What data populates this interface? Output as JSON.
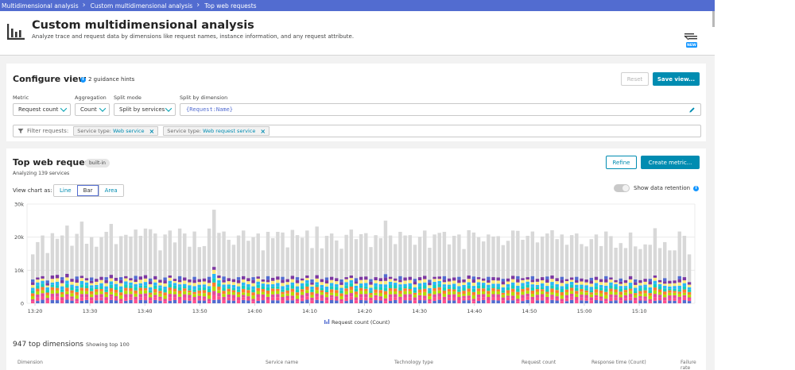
{
  "breadcrumb": [
    "Multidimensional analysis",
    "Custom multidimensional analysis",
    "Top web requests"
  ],
  "header": {
    "title": "Custom multidimensional analysis",
    "subtitle": "Analyze trace and request data by dimensions like request names, instance information, and any request attribute.",
    "new_badge": "NEW"
  },
  "config": {
    "title": "Configure view",
    "hints": "2 guidance hints",
    "reset_label": "Reset",
    "save_label": "Save view...",
    "metric_label": "Metric",
    "metric_value": "Request count",
    "aggregation_label": "Aggregation",
    "aggregation_value": "Count",
    "split_mode_label": "Split mode",
    "split_mode_value": "Split by services",
    "split_dimension_label": "Split by dimension",
    "split_dimension_value": "{Request:Name}",
    "filter_label": "Filter requests:",
    "filters": [
      {
        "key": "Service type:",
        "value": "Web service"
      },
      {
        "key": "Service type:",
        "value": "Web request service"
      }
    ]
  },
  "chart_panel": {
    "title": "Top web requests",
    "badge": "built-in",
    "analyzing": "Analyzing 139 services",
    "refine_label": "Refine",
    "create_metric_label": "Create metric...",
    "view_as_label": "View chart as:",
    "view_options": [
      "Line",
      "Bar",
      "Area"
    ],
    "view_selected": "Bar",
    "retention_label": "Show data retention",
    "legend_label": "Request count (Count)"
  },
  "chart_data": {
    "type": "bar",
    "y_ticks": [
      "30k",
      "20k",
      "10k",
      "0"
    ],
    "ylim": [
      0,
      30000
    ],
    "x_ticks": [
      "13:20",
      "13:30",
      "13:40",
      "13:50",
      "14:00",
      "14:10",
      "14:20",
      "14:30",
      "14:40",
      "14:50",
      "15:00",
      "15:10"
    ],
    "grid": true,
    "series_colors": [
      "#d8d8d8",
      "#7c38a1",
      "#ffe97a",
      "#2ab6f4",
      "#14cfba",
      "#ff7c2d",
      "#b4dc00",
      "#e24a9b",
      "#526cd0",
      "#ff4f8c"
    ],
    "totals": [
      14800,
      18500,
      20500,
      15200,
      21200,
      19500,
      20500,
      23500,
      17400,
      21000,
      24700,
      18000,
      20000,
      17100,
      20000,
      21600,
      24000,
      17900,
      20300,
      20700,
      20200,
      22300,
      20400,
      22600,
      22400,
      21100,
      16000,
      20800,
      22000,
      18400,
      22600,
      21100,
      17100,
      21700,
      17000,
      17300,
      22600,
      28300,
      21300,
      21700,
      19200,
      17700,
      20500,
      22000,
      18900,
      20000,
      21100,
      16000,
      21600,
      19700,
      21600,
      21400,
      16900,
      22200,
      20600,
      19800,
      22000,
      16700,
      23200,
      16600,
      20400,
      21100,
      19000,
      16500,
      20700,
      22300,
      19400,
      20900,
      21200,
      17000,
      20600,
      19700,
      25000,
      20500,
      17900,
      21600,
      20500,
      20600,
      17700,
      20100,
      22000,
      16800,
      20800,
      21300,
      21600,
      17800,
      20400,
      20800,
      16400,
      22100,
      21400,
      20000,
      18700,
      20800,
      20200,
      20300,
      17600,
      18900,
      22000,
      21900,
      19200,
      20400,
      21700,
      18400,
      20200,
      21100,
      22100,
      19400,
      20800,
      17700,
      20600,
      21100,
      17900,
      17200,
      19400,
      20800,
      17300,
      21700,
      20300,
      16800,
      18200,
      16700,
      21400,
      17200,
      16400,
      17800,
      17700,
      22700,
      16700,
      18500,
      16000,
      16000,
      21700,
      20400,
      14800
    ],
    "colored_totals": [
      7200,
      7800,
      8200,
      6900,
      8400,
      8600,
      7900,
      8900,
      7400,
      8100,
      8300,
      7600,
      7800,
      7400,
      8000,
      7900,
      8600,
      7700,
      7900,
      8200,
      7600,
      8300,
      8100,
      8500,
      7500,
      8200,
      7100,
      7800,
      8400,
      7400,
      8200,
      7800,
      7200,
      8000,
      7300,
      7500,
      8000,
      11000,
      8400,
      8100,
      7600,
      7300,
      7900,
      8200,
      7600,
      7900,
      8100,
      7200,
      8200,
      7700,
      8100,
      8000,
      7300,
      8300,
      7900,
      7500,
      8400,
      7200,
      8500,
      7300,
      7800,
      8000,
      7600,
      7200,
      7900,
      8400,
      7600,
      8000,
      8100,
      7300,
      7900,
      7600,
      8800,
      8000,
      7500,
      8200,
      7800,
      8000,
      7400,
      7900,
      8300,
      7100,
      8000,
      8100,
      8200,
      7500,
      7800,
      8000,
      7200,
      8400,
      8100,
      7900,
      7500,
      8000,
      7900,
      7800,
      7400,
      7500,
      8300,
      8200,
      7600,
      7900,
      8200,
      7400,
      7900,
      8100,
      8400,
      7600,
      8000,
      7300,
      7800,
      8000,
      7500,
      7200,
      7700,
      8000,
      7300,
      8200,
      7800,
      7000,
      7500,
      7000,
      8200,
      7200,
      7000,
      7400,
      7400,
      8400,
      7000,
      7600,
      6800,
      6900,
      8200,
      7900,
      6400
    ]
  },
  "dimensions": {
    "count_title": "947 top dimensions",
    "showing": "Showing top 100",
    "columns": [
      "Dimension",
      "Service name",
      "Technology type",
      "Request count",
      "Response time (Count)",
      "Failure rate"
    ]
  }
}
